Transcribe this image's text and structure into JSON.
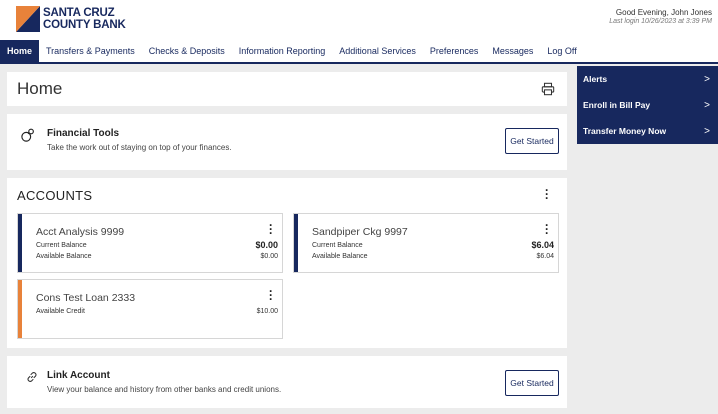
{
  "brand": {
    "line1": "SANTA CRUZ",
    "line2": "COUNTY BANK"
  },
  "user": {
    "greeting": "Good Evening, John Jones",
    "last_login": "Last login 10/26/2023 at 3:39 PM"
  },
  "nav": {
    "items": [
      {
        "label": "Home"
      },
      {
        "label": "Transfers & Payments"
      },
      {
        "label": "Checks & Deposits"
      },
      {
        "label": "Information Reporting"
      },
      {
        "label": "Additional Services"
      },
      {
        "label": "Preferences"
      },
      {
        "label": "Messages"
      },
      {
        "label": "Log Off"
      }
    ]
  },
  "sidebar": {
    "items": [
      {
        "label": "Alerts",
        "chevron": ">"
      },
      {
        "label": "Enroll in Bill Pay",
        "chevron": ">"
      },
      {
        "label": "Transfer Money Now",
        "chevron": ">"
      }
    ]
  },
  "page": {
    "title": "Home"
  },
  "financial_tools": {
    "title": "Financial Tools",
    "description": "Take the work out of staying on top of your finances.",
    "button": "Get Started"
  },
  "accounts": {
    "title": "ACCOUNTS",
    "list": [
      {
        "name": "Acct Analysis 9999",
        "label1": "Current Balance",
        "value1": "$0.00",
        "label2": "Available Balance",
        "value2": "$0.00"
      },
      {
        "name": "Sandpiper Ckg 9997",
        "label1": "Current Balance",
        "value1": "$6.04",
        "label2": "Available Balance",
        "value2": "$6.04"
      },
      {
        "name": "Cons Test Loan 2333",
        "label1": "Available Credit",
        "value1": "$10.00"
      }
    ]
  },
  "link_account": {
    "title": "Link Account",
    "description": "View your balance and history from other banks and credit unions.",
    "button": "Get Started"
  },
  "colors": {
    "navy": "#17285e",
    "orange": "#e8823a",
    "background": "#ececec"
  },
  "icons": {
    "print": "printer-icon",
    "tools": "money-bag-icon",
    "link": "chain-link-icon",
    "menu": "vertical-dots-icon"
  }
}
